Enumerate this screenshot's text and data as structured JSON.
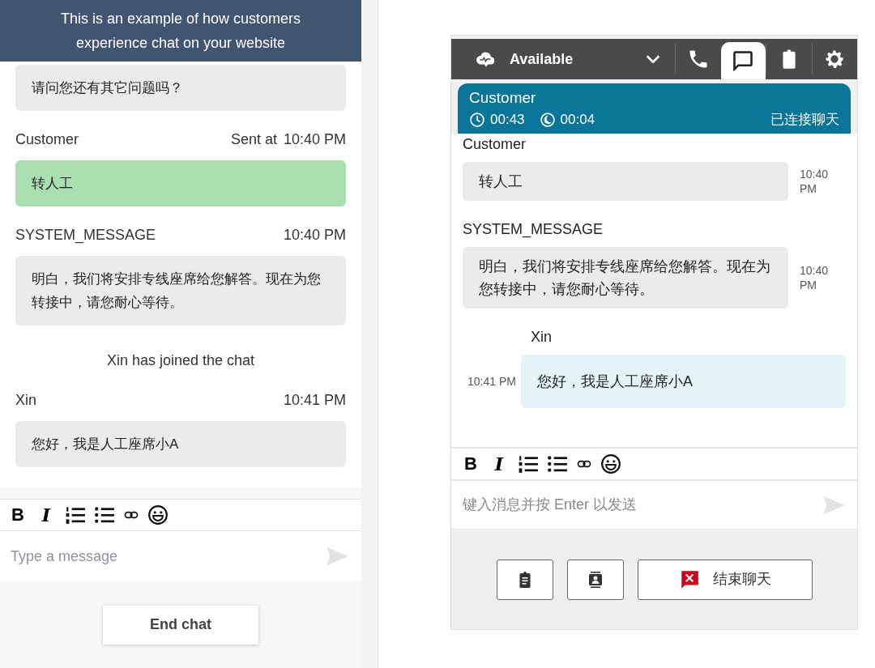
{
  "banner": {
    "text": "This is an example of how customers experience chat on your website"
  },
  "customer_chat": {
    "messages": [
      {
        "kind": "message",
        "own": false,
        "text": "请问您还有其它问题吗？"
      },
      {
        "kind": "message",
        "own": true,
        "sender": "Customer",
        "time_prefix": "Sent at",
        "time": "10:40 PM",
        "text": "转人工"
      },
      {
        "kind": "message",
        "own": false,
        "sender": "SYSTEM_MESSAGE",
        "time": "10:40 PM",
        "text": "明白，我们将安排专线座席给您解答。现在为您转接中，请您耐心等待。"
      },
      {
        "kind": "event",
        "text": "Xin has joined the chat"
      },
      {
        "kind": "message",
        "own": false,
        "sender": "Xin",
        "time": "10:41 PM",
        "text": "您好，我是人工座席小A"
      }
    ],
    "toolbar": [
      {
        "kind": "bold",
        "label": "B"
      },
      {
        "kind": "italic",
        "label": "I"
      },
      {
        "kind": "ordered-list"
      },
      {
        "kind": "bullet-list"
      },
      {
        "kind": "link"
      },
      {
        "kind": "emoji"
      }
    ],
    "composer": {
      "placeholder": "Type a message"
    },
    "end_button": "End chat"
  },
  "agent_panel": {
    "status": "Available",
    "tabs": [
      {
        "kind": "phone",
        "selected": false
      },
      {
        "kind": "chat",
        "selected": true
      },
      {
        "kind": "tasks",
        "selected": false
      },
      {
        "kind": "settings",
        "selected": false
      }
    ],
    "contact": {
      "name": "Customer",
      "duration": "00:43",
      "wait": "00:04",
      "state": "已连接聊天"
    },
    "messages": [
      {
        "own": false,
        "sender": "Customer",
        "text": "转人工",
        "time": "10:40 PM"
      },
      {
        "own": false,
        "sender": "SYSTEM_MESSAGE",
        "text": "明白，我们将安排专线座席给您解答。现在为您转接中，请您耐心等待。",
        "time": "10:40 PM"
      },
      {
        "own": true,
        "sender": "Xin",
        "text": "您好，我是人工座席小A",
        "time": "10:41 PM"
      }
    ],
    "toolbar": [
      {
        "kind": "bold",
        "label": "B"
      },
      {
        "kind": "italic",
        "label": "I"
      },
      {
        "kind": "ordered-list"
      },
      {
        "kind": "bullet-list"
      },
      {
        "kind": "link"
      },
      {
        "kind": "emoji"
      }
    ],
    "composer": {
      "placeholder": "键入消息并按 Enter 以发送"
    },
    "actions": [
      {
        "kind": "tasks"
      },
      {
        "kind": "contact"
      },
      {
        "kind": "end",
        "label": "结束聊天"
      }
    ]
  }
}
